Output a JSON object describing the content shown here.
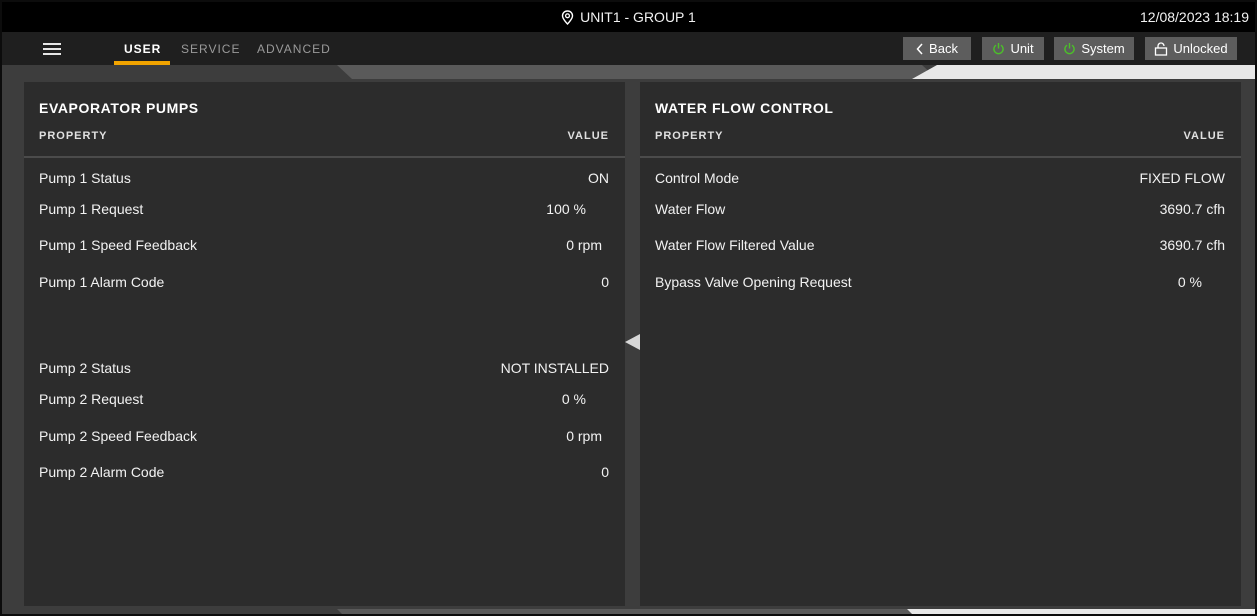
{
  "titlebar": {
    "unit_group": "UNIT1 - GROUP 1",
    "datetime": "12/08/2023 18:19"
  },
  "nav": {
    "tabs": [
      {
        "label": "USER",
        "active": true
      },
      {
        "label": "SERVICE",
        "active": false
      },
      {
        "label": "ADVANCED",
        "active": false
      }
    ],
    "buttons": {
      "back": "Back",
      "unit": "Unit",
      "system": "System",
      "lock": "Unlocked"
    },
    "icons": {
      "menu": "hamburger-menu-icon",
      "location": "location-pin-icon",
      "back": "chevron-left-icon",
      "power": "power-icon",
      "lock": "unlocked-padlock-icon"
    }
  },
  "colors": {
    "accent": "#f2a400",
    "power_green": "#4cbf2a",
    "panel_bg": "#2c2c2c",
    "page_bg": "#3d3d3d",
    "button_bg": "#5d5d5d"
  },
  "left_panel": {
    "title": "EVAPORATOR PUMPS",
    "col_property": "PROPERTY",
    "col_value": "VALUE",
    "rows": [
      {
        "label": "Pump 1 Status",
        "value": "ON"
      },
      {
        "label": "Pump 1 Request",
        "value": "100 %"
      },
      {
        "label": "Pump 1 Speed Feedback",
        "value": "0 rpm"
      },
      {
        "label": "Pump 1 Alarm Code",
        "value": "0"
      },
      {
        "label": "Pump 2 Status",
        "value": "NOT INSTALLED"
      },
      {
        "label": "Pump 2 Request",
        "value": "0 %"
      },
      {
        "label": "Pump 2 Speed Feedback",
        "value": "0 rpm"
      },
      {
        "label": "Pump 2 Alarm Code",
        "value": "0"
      }
    ]
  },
  "right_panel": {
    "title": "WATER FLOW CONTROL",
    "col_property": "PROPERTY",
    "col_value": "VALUE",
    "rows": [
      {
        "label": "Control Mode",
        "value": "FIXED FLOW"
      },
      {
        "label": "Water Flow",
        "value": "3690.7 cfh"
      },
      {
        "label": "Water Flow Filtered Value",
        "value": "3690.7 cfh"
      },
      {
        "label": "Bypass Valve Opening Request",
        "value": "0 %"
      }
    ]
  }
}
